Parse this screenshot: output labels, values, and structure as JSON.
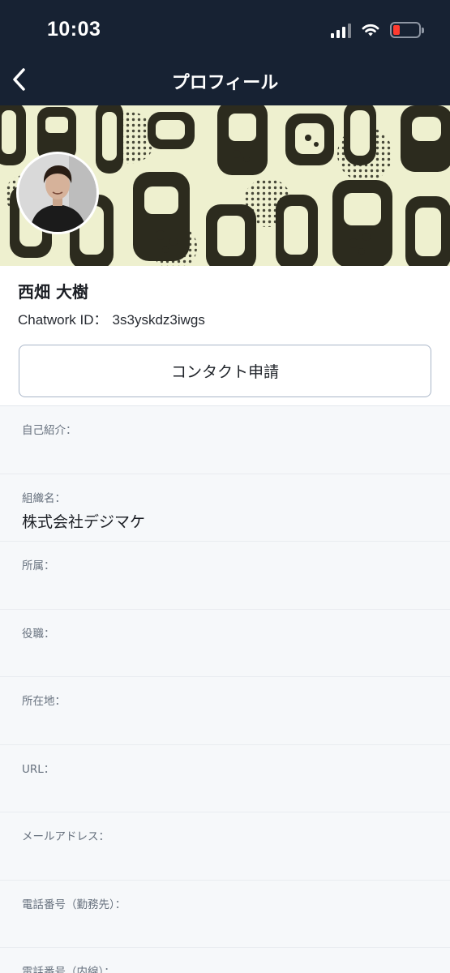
{
  "status_bar": {
    "time": "10:03"
  },
  "nav": {
    "title": "プロフィール"
  },
  "profile": {
    "name": "西畑 大樹",
    "chatwork_id_label": "Chatwork ID：",
    "chatwork_id": "3s3yskdz3iwgs",
    "contact_button": "コンタクト申請"
  },
  "fields": [
    {
      "label": "自己紹介：",
      "value": ""
    },
    {
      "label": "組織名：",
      "value": "株式会社デジマケ"
    },
    {
      "label": "所属：",
      "value": ""
    },
    {
      "label": "役職：",
      "value": ""
    },
    {
      "label": "所在地：",
      "value": ""
    },
    {
      "label": "URL：",
      "value": ""
    },
    {
      "label": "メールアドレス：",
      "value": ""
    },
    {
      "label": "電話番号（勤務先）：",
      "value": ""
    },
    {
      "label": "電話番号（内線）：",
      "value": ""
    }
  ],
  "colors": {
    "header_bg": "#172233",
    "cover_bg": "#eef0cf",
    "battery_low": "#ff3b30"
  }
}
